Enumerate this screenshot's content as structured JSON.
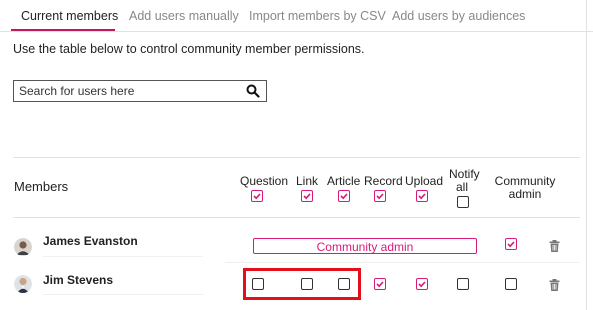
{
  "tabs": [
    {
      "label": "Current members",
      "active": true
    },
    {
      "label": "Add users manually",
      "active": false
    },
    {
      "label": "Import members by CSV",
      "active": false
    },
    {
      "label": "Add users by audiences",
      "active": false
    }
  ],
  "description": "Use the table below to control community member permissions.",
  "search": {
    "placeholder": "Search for users here",
    "value": "",
    "icon": "search-icon"
  },
  "table": {
    "members_label": "Members",
    "columns": [
      {
        "label": "Question",
        "header_checked": true
      },
      {
        "label": "Link",
        "header_checked": true
      },
      {
        "label": "Article",
        "header_checked": true
      },
      {
        "label": "Record",
        "header_checked": true
      },
      {
        "label": "Upload",
        "header_checked": true
      },
      {
        "label": "Notify all",
        "label_line1": "Notify",
        "label_line2": "all",
        "header_checked": false
      },
      {
        "label": "Community admin",
        "label_line1": "Community",
        "label_line2": "admin"
      }
    ],
    "rows": [
      {
        "name": "James Evanston",
        "admin_badge": "Community admin",
        "community_admin": true
      },
      {
        "name": "Jim Stevens",
        "question": false,
        "link": false,
        "article": false,
        "record": true,
        "upload": true,
        "notify_all": false,
        "community_admin": false
      }
    ]
  },
  "colors": {
    "accent": "#d81b7a",
    "highlight": "#e3101b",
    "tab_underline": "#c2185b"
  }
}
